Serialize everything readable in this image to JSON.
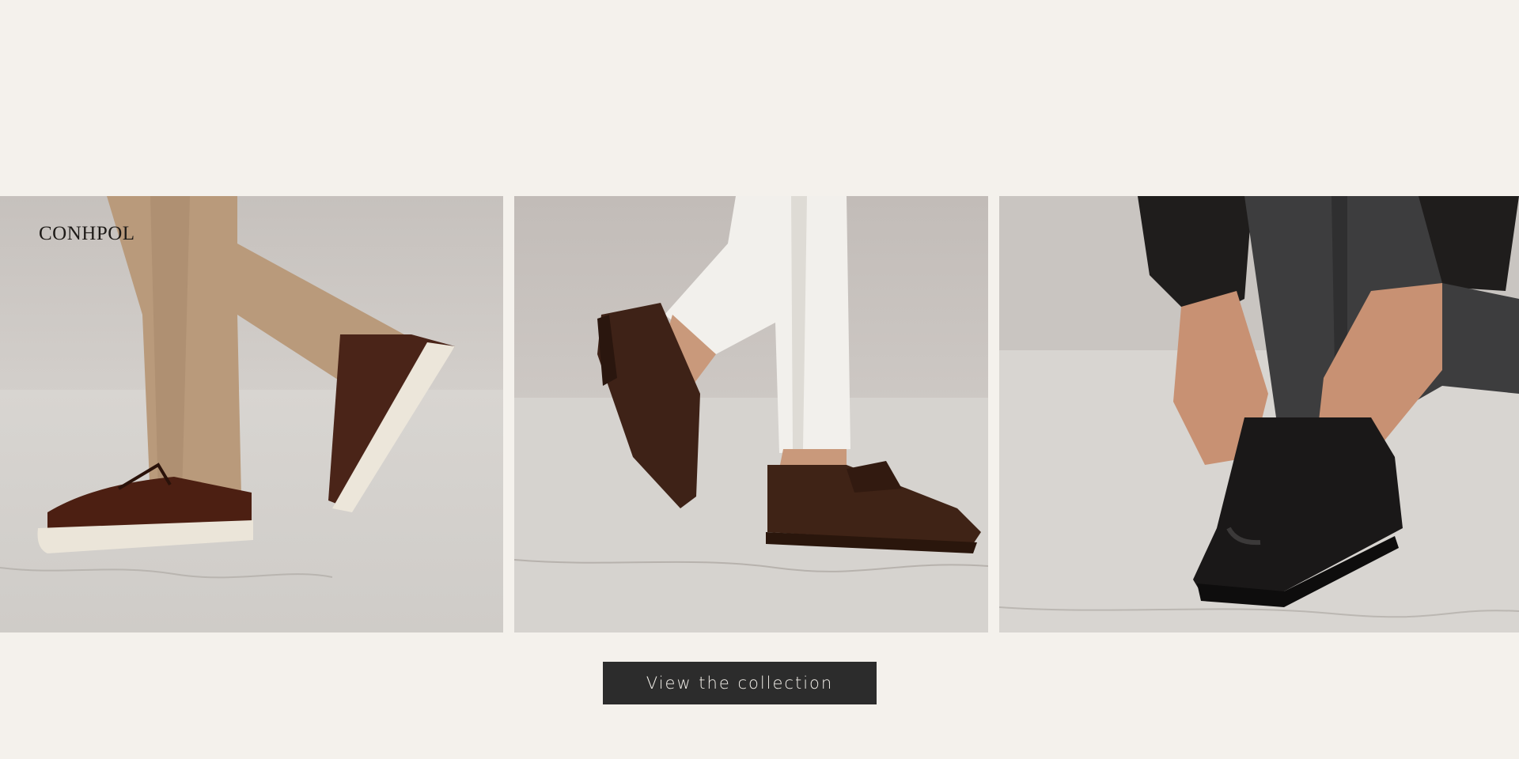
{
  "brand": {
    "logo_text": "CONHPOL"
  },
  "gallery": {
    "images": [
      {
        "icon": "brown-leather-sneakers-photo"
      },
      {
        "icon": "brown-suede-loafers-photo"
      },
      {
        "icon": "black-leather-derby-shoes-photo"
      }
    ]
  },
  "cta": {
    "label": "View the collection"
  },
  "colors": {
    "background": "#f4f1ec",
    "button": "#2c2c2c",
    "button_text": "#f2efe9"
  }
}
